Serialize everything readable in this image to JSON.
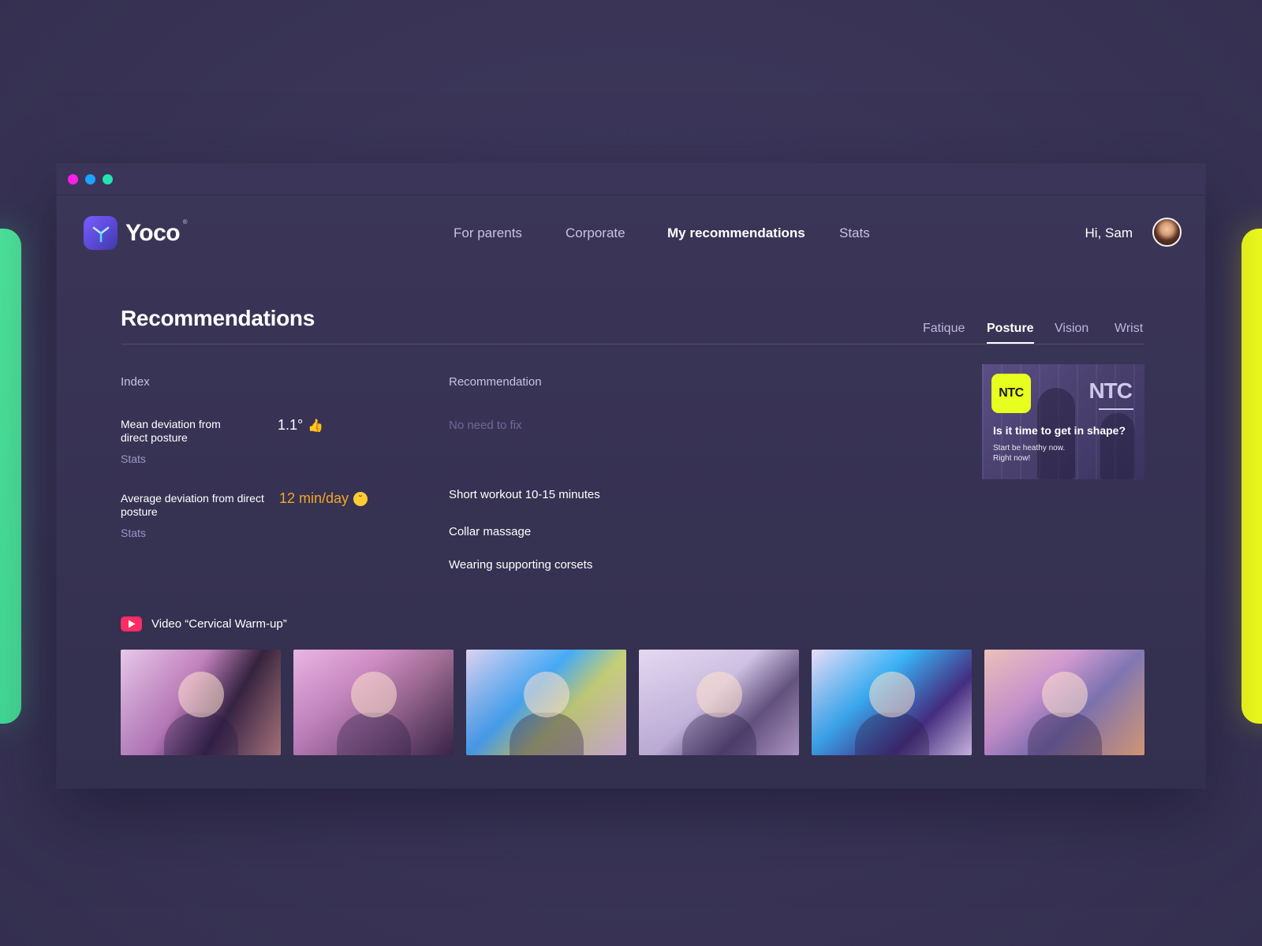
{
  "window": {
    "traffic_lights": [
      "#ff1ee8",
      "#1aa3ff",
      "#22e3b0"
    ]
  },
  "brand": {
    "name": "Yoco",
    "registered": "®",
    "icon": "yoco-logo-icon"
  },
  "nav": {
    "links": [
      {
        "label": "For parents",
        "active": false
      },
      {
        "label": "Corporate",
        "active": false
      },
      {
        "label": "My recommendations",
        "active": true
      },
      {
        "label": "Stats",
        "active": false
      }
    ],
    "greeting": "Hi, Sam"
  },
  "page": {
    "title": "Recommendations",
    "tabs": [
      {
        "label": "Fatique",
        "active": false
      },
      {
        "label": "Posture",
        "active": true
      },
      {
        "label": "Vision",
        "active": false
      },
      {
        "label": "Wrist",
        "active": false
      }
    ]
  },
  "table": {
    "index_header": "Index",
    "recommendation_header": "Recommendation",
    "metrics": [
      {
        "label": "Mean deviation from direct posture",
        "value": "1.1°",
        "value_icon": "thumbs-up-icon",
        "link": "Stats",
        "recommendation": "No need to fix"
      },
      {
        "label": "Average deviation from direct posture",
        "value": "12 min/day",
        "value_icon": "pensive-face-icon",
        "link": "Stats",
        "recommendations": [
          "Short workout 10-15 minutes",
          "Collar massage",
          "Wearing supporting corsets"
        ]
      }
    ]
  },
  "promo": {
    "badge": "NTC",
    "headline": "Is it time to get in shape?",
    "sub_line1": "Start be heathy now.",
    "sub_line2": "Right now!"
  },
  "video": {
    "title": "Video “Cervical Warm-up”",
    "icon": "play-icon",
    "thumbnails": 6
  },
  "colors": {
    "accent_warn": "#f5a623",
    "ntc_yellow": "#e7ff1f",
    "play_red": "#ff2d63",
    "left_card": "#4ce39a",
    "right_card": "#eefc1c"
  }
}
